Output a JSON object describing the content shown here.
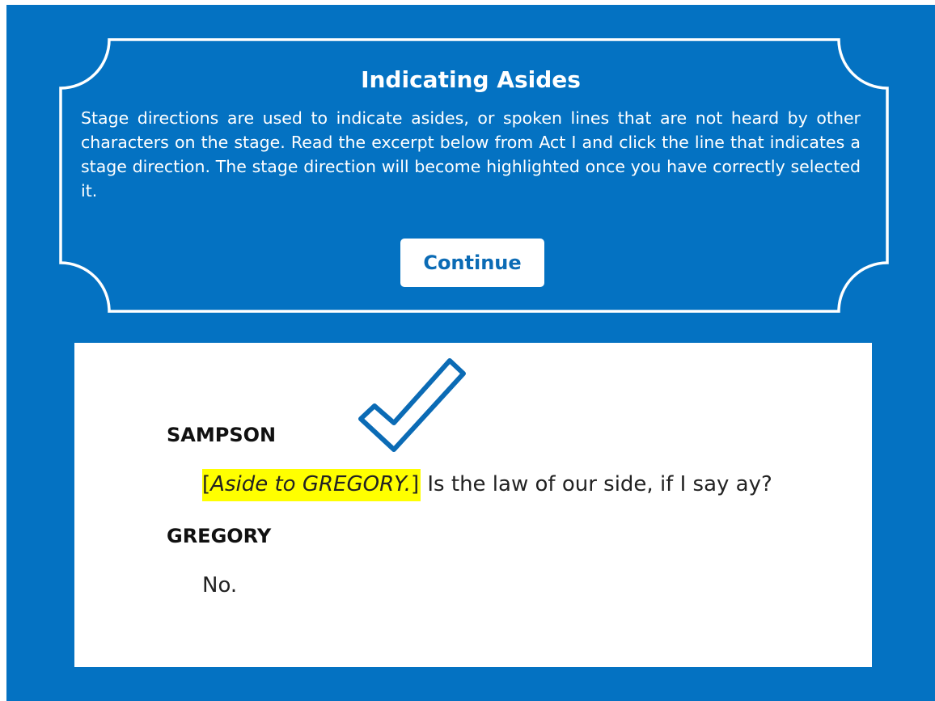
{
  "colors": {
    "background": "#0472c2",
    "highlight": "#ffff00",
    "button_text": "#0b6bb5",
    "checkmark": "#0b6bb5"
  },
  "instructions": {
    "title": "Indicating Asides",
    "body": "Stage directions are used to indicate asides, or spoken lines that are not heard by other characters on the stage. Read the excerpt below from Act I and click the line that indicates a stage direction. The stage direction will become highlighted once you have correctly selected it.",
    "continue_label": "Continue"
  },
  "excerpt": {
    "checkmark_icon": "check-icon",
    "lines": [
      {
        "speaker": "SAMPSON",
        "bracket_open": "[",
        "direction": "Aside to GREGORY.",
        "bracket_close": "]",
        "text": " Is the law of our side, if I say ay?",
        "highlighted": true
      },
      {
        "speaker": "GREGORY",
        "text": "No."
      }
    ]
  }
}
